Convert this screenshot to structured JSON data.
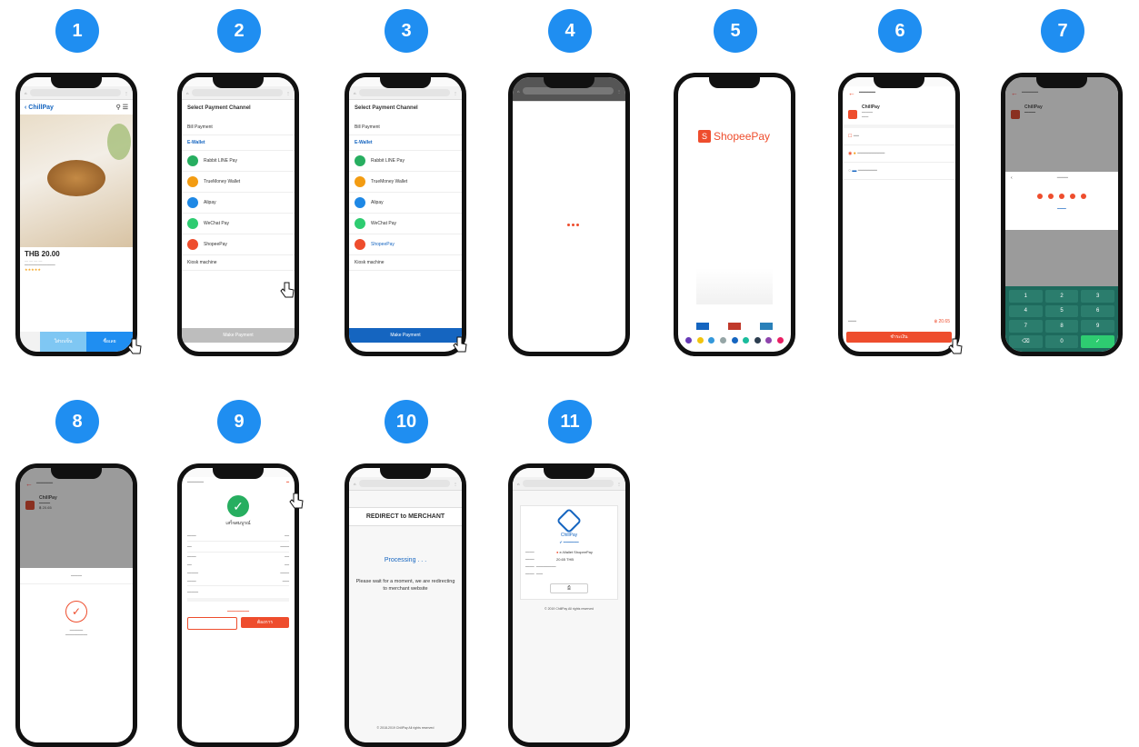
{
  "steps": [
    {
      "number": "1",
      "brand": "ChillPay",
      "price": "THB 20.00",
      "buy_button": "ซื้อเลย",
      "cart_button": "ใส่รถเข็น"
    },
    {
      "number": "2",
      "title": "Select Payment Channel",
      "items": [
        "Bill Payment",
        "E-Wallet",
        "Rabbit LINE Pay",
        "TrueMoney Wallet",
        "Alipay",
        "WeChat Pay",
        "ShopeePay",
        "Kiosk machine"
      ],
      "button": "Make Payment"
    },
    {
      "number": "3",
      "title": "Select Payment Channel",
      "items": [
        "Bill Payment",
        "E-Wallet",
        "Rabbit LINE Pay",
        "TrueMoney Wallet",
        "Alipay",
        "WeChat Pay",
        "ShopeePay",
        "Kiosk machine"
      ],
      "button": "Make Payment"
    },
    {
      "number": "4"
    },
    {
      "number": "5",
      "brand": "ShopeePay"
    },
    {
      "number": "6",
      "merchant": "ChillPay",
      "amount": "฿ 20.65",
      "pay_button": "ชำระเงิน"
    },
    {
      "number": "7",
      "merchant": "ChillPay",
      "keys": [
        "1",
        "2",
        "3",
        "4",
        "5",
        "6",
        "7",
        "8",
        "9",
        "⌫",
        "0",
        "✓"
      ]
    },
    {
      "number": "8",
      "merchant": "ChillPay",
      "amount": "฿ 20.65"
    },
    {
      "number": "9",
      "status": "เสร็จสมบูรณ์",
      "confirm_button": "ต้องการ"
    },
    {
      "number": "10",
      "header": "REDIRECT to MERCHANT",
      "processing": "Processing . . .",
      "message": "Please wait for a moment, we are redirecting to merchant website",
      "footer": "© 2018-2019 ChillPay All rights reserved"
    },
    {
      "number": "11",
      "brand": "ChillPay",
      "amount": "20.65 THB",
      "method": "e-Wallet ShopeePay",
      "footer": "© 2019 ChillPay All rights reserved"
    }
  ],
  "colors": {
    "badge": "#1f8ef1",
    "shopee": "#ee4d2d",
    "chillpay_blue": "#1565c0"
  }
}
